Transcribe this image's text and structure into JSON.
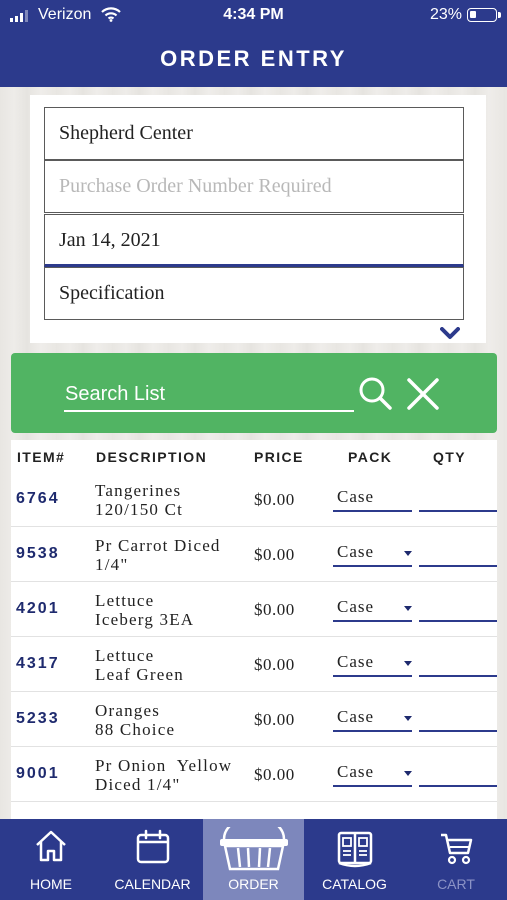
{
  "status_bar": {
    "carrier": "Verizon",
    "time": "4:34 PM",
    "battery": "23%"
  },
  "header": {
    "title": "ORDER ENTRY"
  },
  "form": {
    "customer": "Shepherd Center",
    "po_placeholder": "Purchase Order Number Required",
    "po_value": "",
    "date": "Jan 14, 2021",
    "specification": "Specification"
  },
  "search": {
    "placeholder": "Search List"
  },
  "table": {
    "headers": {
      "item": "ITEM#",
      "description": "DESCRIPTION",
      "price": "PRICE",
      "pack": "PACK",
      "qty": "QTY"
    },
    "rows": [
      {
        "item": "6764",
        "description": "Tangerines\n120/150 Ct",
        "price": "$0.00",
        "pack": "Case",
        "has_dropdown": false
      },
      {
        "item": "9538",
        "description": "Pr Carrot Diced\n1/4\"",
        "price": "$0.00",
        "pack": "Case",
        "has_dropdown": true
      },
      {
        "item": "4201",
        "description": "Lettuce\nIceberg 3EA",
        "price": "$0.00",
        "pack": "Case",
        "has_dropdown": true
      },
      {
        "item": "4317",
        "description": "Lettuce\nLeaf Green",
        "price": "$0.00",
        "pack": "Case",
        "has_dropdown": true
      },
      {
        "item": "5233",
        "description": "Oranges\n88 Choice",
        "price": "$0.00",
        "pack": "Case",
        "has_dropdown": true
      },
      {
        "item": "9001",
        "description": "Pr Onion  Yellow\nDiced 1/4\"",
        "price": "$0.00",
        "pack": "Case",
        "has_dropdown": true
      }
    ]
  },
  "tabs": [
    {
      "label": "HOME",
      "icon": "home-icon"
    },
    {
      "label": "CALENDAR",
      "icon": "calendar-icon"
    },
    {
      "label": "ORDER",
      "icon": "basket-icon",
      "active": true
    },
    {
      "label": "CATALOG",
      "icon": "catalog-icon"
    },
    {
      "label": "CART",
      "icon": "cart-icon",
      "disabled": true
    }
  ],
  "colors": {
    "primary": "#2c3a8c",
    "search_green": "#51b463",
    "active_tab": "#7d87bc"
  }
}
